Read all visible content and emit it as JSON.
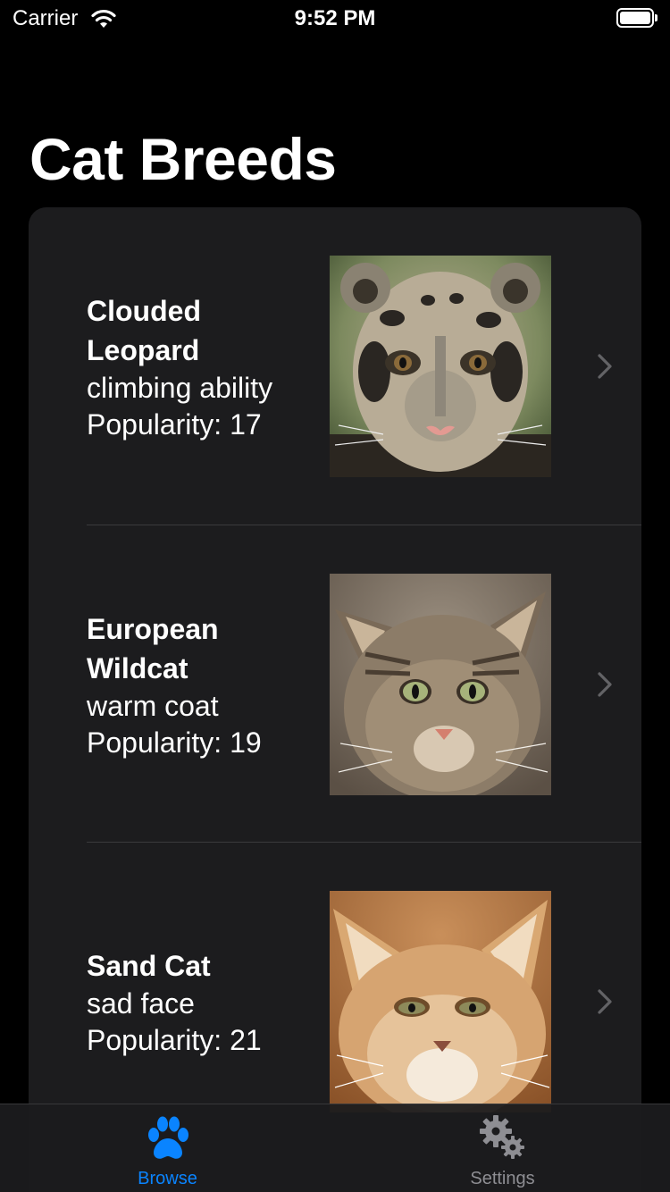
{
  "status_bar": {
    "carrier": "Carrier",
    "time": "9:52 PM",
    "battery_level": 1.0
  },
  "page_title": "Cat Breeds",
  "breeds": [
    {
      "name_line1": "Clouded",
      "name_line2": "Leopard",
      "trait": "climbing ability",
      "popularity": "Popularity: 17",
      "image": "clouded-leopard-photo"
    },
    {
      "name_line1": "European",
      "name_line2": "Wildcat",
      "trait": "warm coat",
      "popularity": "Popularity: 19",
      "image": "european-wildcat-photo"
    },
    {
      "name_line1": "Sand Cat",
      "name_line2": "",
      "trait": "sad face",
      "popularity": "Popularity: 21",
      "image": "sand-cat-photo"
    }
  ],
  "tabs": [
    {
      "label": "Browse",
      "icon": "paw-icon",
      "selected": true
    },
    {
      "label": "Settings",
      "icon": "gears-icon",
      "selected": false
    }
  ],
  "colors": {
    "accent": "#0a84ff",
    "card": "#1c1c1e",
    "inactive_tab": "#8e8e93"
  }
}
